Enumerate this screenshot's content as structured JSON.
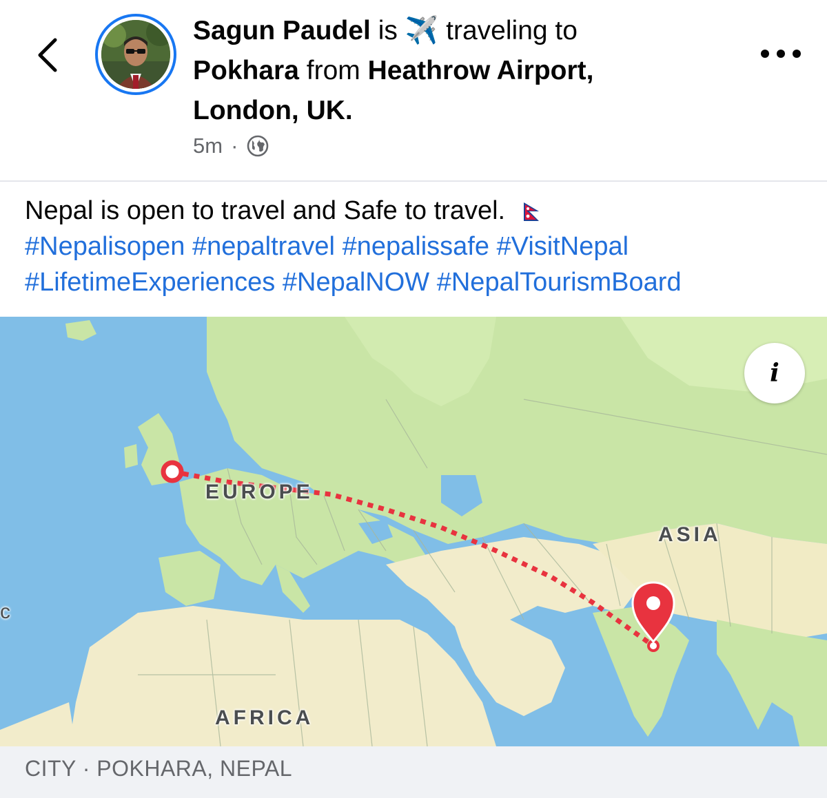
{
  "header": {
    "back_icon": "chevron-left-icon",
    "author": "Sagun Paudel",
    "is": "is",
    "plane_emoji": "✈️",
    "activity": "traveling to",
    "destination": "Pokhara",
    "from": "from",
    "origin": "Heathrow Airport, London, UK.",
    "time": "5m",
    "separator": "·",
    "privacy_icon": "globe-icon",
    "more_icon": "more-dots-icon"
  },
  "post": {
    "text": "Nepal is open to travel and Safe to travel.",
    "flag_icon": "nepal-flag-icon",
    "hashtags": [
      "#Nepalisopen",
      "#nepaltravel",
      "#nepalissafe",
      "#VisitNepal",
      "#LifetimeExperiences",
      "#NepalNOW",
      "#NepalTourismBoard"
    ]
  },
  "map": {
    "labels": {
      "europe": "EUROPE",
      "asia": "ASIA",
      "africa": "AFRICA"
    },
    "edge_letter": "c",
    "info_label": "i",
    "route_color": "#e8333f",
    "pin_icon": "location-pin-icon",
    "land_color": "#c8e4a8",
    "water_color": "#7fbde6"
  },
  "footer": {
    "place_info": "CITY · POKHARA, NEPAL"
  }
}
